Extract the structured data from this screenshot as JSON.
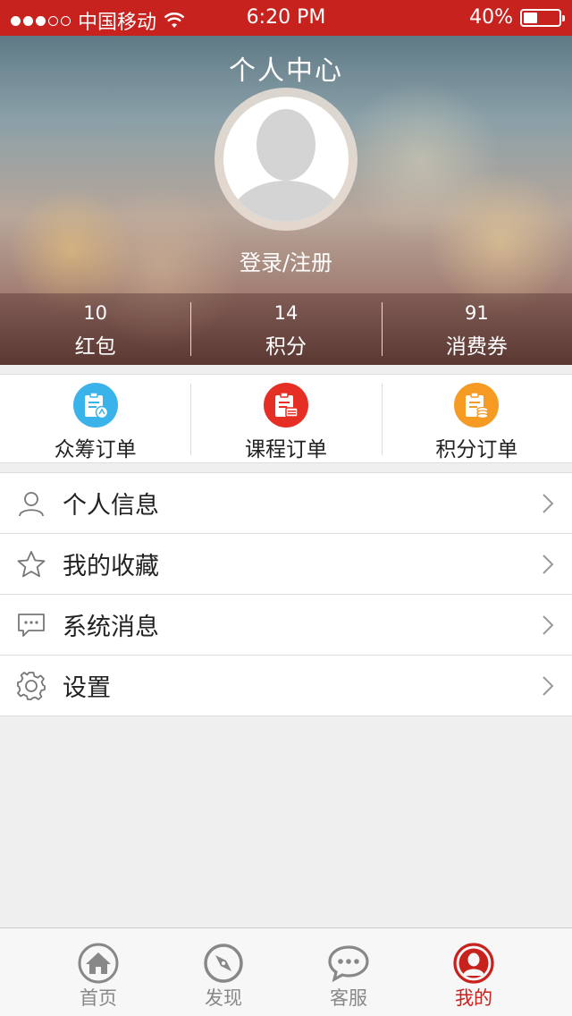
{
  "status_bar": {
    "carrier": "中国移动",
    "time": "6:20 PM",
    "battery": "40%",
    "battery_level": 0.4
  },
  "header": {
    "title": "个人中心",
    "login_link": "登录/注册"
  },
  "stats": [
    {
      "value": "10",
      "label": "红包"
    },
    {
      "value": "14",
      "label": "积分"
    },
    {
      "value": "91",
      "label": "消费券"
    }
  ],
  "orders": [
    {
      "label": "众筹订单",
      "icon": "crowdfund-order-icon",
      "color": "#3ab3ea"
    },
    {
      "label": "课程订单",
      "icon": "course-order-icon",
      "color": "#e62f24"
    },
    {
      "label": "积分订单",
      "icon": "points-order-icon",
      "color": "#f59a23"
    }
  ],
  "menu": [
    {
      "label": "个人信息",
      "icon": "user-icon"
    },
    {
      "label": "我的收藏",
      "icon": "star-icon"
    },
    {
      "label": "系统消息",
      "icon": "message-icon"
    },
    {
      "label": "设置",
      "icon": "gear-icon"
    }
  ],
  "tabbar": [
    {
      "label": "首页",
      "icon": "home-icon",
      "active": false
    },
    {
      "label": "发现",
      "icon": "compass-icon",
      "active": false
    },
    {
      "label": "客服",
      "icon": "chat-icon",
      "active": false
    },
    {
      "label": "我的",
      "icon": "profile-icon",
      "active": true
    }
  ],
  "colors": {
    "brand": "#c8221f",
    "tab_inactive": "#888888"
  }
}
